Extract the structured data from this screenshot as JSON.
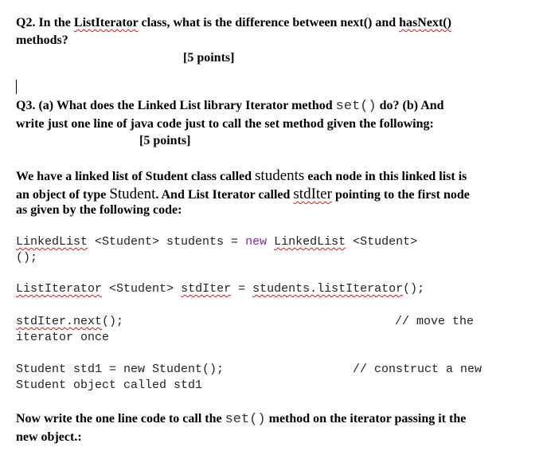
{
  "q2": {
    "line1_a": "Q2. In the ",
    "line1_class": "ListIterator",
    "line1_b": " class, what is the difference between next() and ",
    "line1_method": "hasNext()",
    "line2": "methods?",
    "points": "[5 points]"
  },
  "q3": {
    "line1_a": "Q3. (a) What does the Linked List library Iterator method ",
    "line1_code": "set()",
    "line1_b": " do? (b) And",
    "line2": "write just one line of java code just to call the set method given the following:",
    "points": "[5 points]"
  },
  "context": {
    "line1_a": "We have a linked list of Student class called ",
    "line1_name": "students",
    "line1_b": " each node in this linked list is",
    "line2_a": "an object of type ",
    "line2_type": "Student",
    "line2_b": ". And List Iterator called ",
    "line2_var": "stdIter",
    "line2_c": " pointing to the first node",
    "line3": "as given by the following code:"
  },
  "code": {
    "l1_type": "LinkedList",
    "l1_a": " <Student> students = ",
    "l1_new": "new",
    "l1_sp": " ",
    "l1_type2": "LinkedList",
    "l1_b": " <Student>",
    "l2": "();",
    "l3_type": "ListIterator",
    "l3_a": " <Student> ",
    "l3_var": "stdIter",
    "l3_b": " = ",
    "l3_call": "students.listIterator",
    "l3_c": "();",
    "l4_call": "stdIter.next",
    "l4_a": "();",
    "l4_comment": "// move the",
    "l5": "iterator once",
    "l6": "Student std1 = new Student();",
    "l6_comment": "// construct a new",
    "l7": "Student object called std1"
  },
  "final": {
    "line1_a": "Now write the one line code to call the ",
    "line1_code": "set()",
    "line1_b": " method on the iterator passing it the",
    "line2": "new object.:"
  }
}
